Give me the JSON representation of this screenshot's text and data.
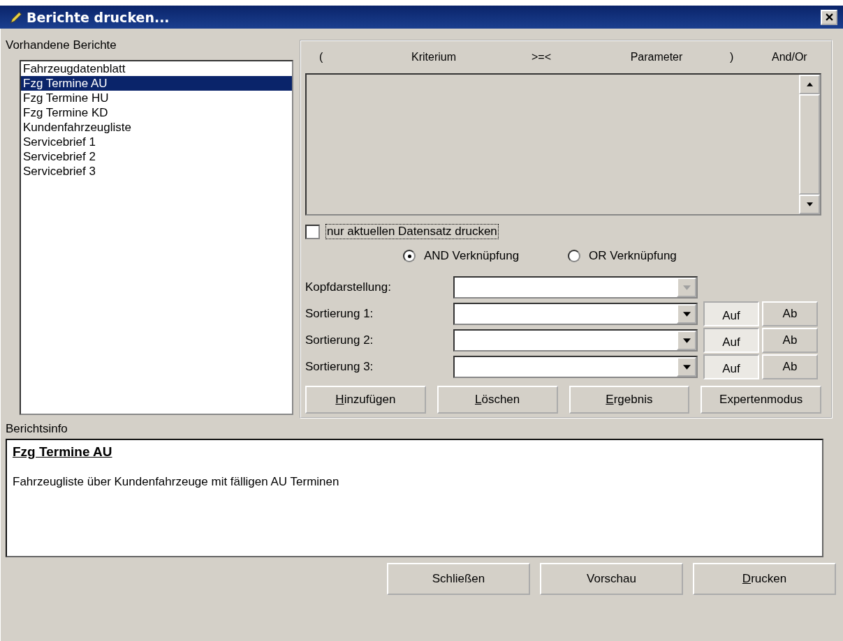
{
  "window": {
    "title": "Berichte drucken..."
  },
  "reports": {
    "label": "Vorhandene Berichte",
    "items": [
      {
        "label": "Fahrzeugdatenblatt",
        "selected": false
      },
      {
        "label": "Fzg Termine AU",
        "selected": true
      },
      {
        "label": "Fzg Termine HU",
        "selected": false
      },
      {
        "label": "Fzg Termine KD",
        "selected": false
      },
      {
        "label": "Kundenfahrzeugliste",
        "selected": false
      },
      {
        "label": "Servicebrief 1",
        "selected": false
      },
      {
        "label": "Servicebrief 2",
        "selected": false
      },
      {
        "label": "Servicebrief 3",
        "selected": false
      }
    ]
  },
  "criteria": {
    "columns": [
      "(",
      "Kriterium",
      ">=<",
      "Parameter",
      ")",
      "And/Or"
    ]
  },
  "current_record_only": {
    "label": "nur aktuellen Datensatz drucken",
    "checked": false
  },
  "link_mode": [
    {
      "label": "AND Verknüpfung",
      "selected": true
    },
    {
      "label": "OR Verknüpfung",
      "selected": false
    }
  ],
  "fields": [
    {
      "label": "Kopfdarstellung:",
      "disabled": true
    },
    {
      "label": "Sortierung 1:",
      "disabled": false,
      "order": [
        {
          "label": "Auf",
          "selected": true
        },
        {
          "label": "Ab",
          "selected": false
        }
      ]
    },
    {
      "label": "Sortierung 2:",
      "disabled": false,
      "order": [
        {
          "label": "Auf",
          "selected": true
        },
        {
          "label": "Ab",
          "selected": false
        }
      ]
    },
    {
      "label": "Sortierung 3:",
      "disabled": false,
      "order": [
        {
          "label": "Auf",
          "selected": true
        },
        {
          "label": "Ab",
          "selected": false
        }
      ]
    }
  ],
  "actions": [
    {
      "label": "Hinzufügen",
      "accelerator": true
    },
    {
      "label": "Löschen",
      "accelerator": true
    },
    {
      "label": "Ergebnis",
      "accelerator": true
    },
    {
      "label": "Expertenmodus",
      "accelerator": false
    }
  ],
  "info": {
    "label": "Berichtsinfo",
    "title": "Fzg Termine AU",
    "text": "Fahrzeugliste über Kundenfahrzeuge mit fälligen AU Terminen"
  },
  "buttons": [
    {
      "label": "Schließen",
      "accelerator": false
    },
    {
      "label": "Vorschau",
      "accelerator": false
    },
    {
      "label": "Drucken",
      "accelerator": true
    }
  ]
}
